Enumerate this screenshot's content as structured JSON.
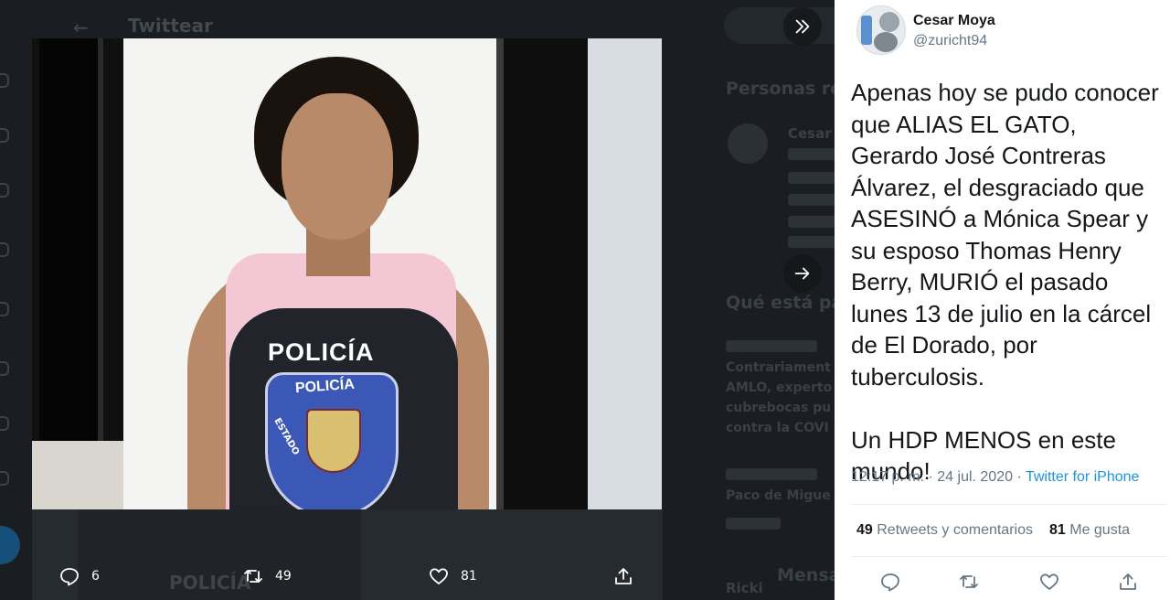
{
  "background": {
    "header_title": "Twittear",
    "sidebar_heading_1": "Personas re",
    "sidebar_heading_2": "Qué está pa",
    "sidebar_heading_3": "Mensa",
    "sidebar_user": "Cesar",
    "trend_1": "Contrariament",
    "trend_2": "AMLO, experto",
    "trend_3": "cubrebocas pu",
    "trend_4": "contra la COVI",
    "trend_user": "Paco de Migue",
    "bottom_user": "Ricki",
    "image_overlay_text": "POLICÍA"
  },
  "media": {
    "photo_text_main": "POLICÍA",
    "photo_text_badge": "POLICÍA",
    "photo_text_side": "ESTADO",
    "reply_count": "6",
    "retweet_count": "49",
    "like_count": "81"
  },
  "tweet": {
    "display_name": "Cesar Moya",
    "handle": "@zuricht94",
    "text": "Apenas hoy se pudo conocer que ALIAS EL GATO, Gerardo José Contreras Álvarez, el desgraciado que ASESINÓ a Mónica Spear y su esposo Thomas Henry Berry, MURIÓ el pasado lunes 13 de julio en la cárcel de El Dorado, por tuberculosis.\n\nUn HDP MENOS en este mundo!",
    "time": "12:17 p. m.",
    "separator": " · ",
    "date": "24 jul. 2020",
    "source": "Twitter for iPhone",
    "retweets_count": "49",
    "retweets_label": "Retweets y comentarios",
    "likes_count": "81",
    "likes_label": "Me gusta"
  },
  "icons": {
    "collapse": "double-chevron-right-icon",
    "next": "arrow-right-icon",
    "reply": "reply-icon",
    "retweet": "retweet-icon",
    "like": "heart-icon",
    "share": "share-icon"
  },
  "colors": {
    "link": "#1b95e0",
    "secondary_text": "#657786",
    "overlay": "#14171a"
  }
}
